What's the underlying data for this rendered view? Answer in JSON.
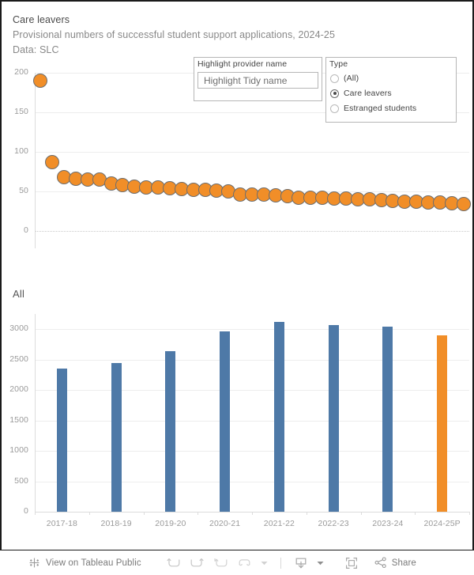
{
  "header": {
    "title": "Care leavers",
    "subtitle": "Provisional numbers of successful student support applications, 2024-25",
    "source": "Data: SLC"
  },
  "filters": {
    "highlight": {
      "title": "Highlight provider name",
      "placeholder": "Highlight Tidy name",
      "value": "",
      "icon": "search-icon"
    },
    "type": {
      "title": "Type",
      "selected": "Care leavers",
      "options": [
        {
          "label": "(All)",
          "checked": false
        },
        {
          "label": "Care leavers",
          "checked": true
        },
        {
          "label": "Estranged students",
          "checked": false
        }
      ]
    }
  },
  "sections": {
    "bar_section_label": "All"
  },
  "colors": {
    "orange": "#f18e28",
    "blue": "#4e79a7",
    "grid": "#ededed",
    "axis_text": "#9a9a9a",
    "title_text": "#4a4a4a",
    "subtitle_text": "#888888"
  },
  "chart_data": [
    {
      "type": "scatter",
      "title": "Care leavers",
      "xlabel": "",
      "ylabel": "",
      "ylim": [
        0,
        200
      ],
      "yticks": [
        0,
        50,
        100,
        150,
        200
      ],
      "grid": true,
      "legend": "none",
      "point_color": "#f18e28",
      "x": [
        1,
        2,
        3,
        4,
        5,
        6,
        7,
        8,
        9,
        10,
        11,
        12,
        13,
        14,
        15,
        16,
        17,
        18,
        19,
        20,
        21,
        22,
        23,
        24,
        25,
        26,
        27,
        28,
        29,
        30,
        31,
        32,
        33,
        34,
        35,
        36,
        37
      ],
      "values": [
        190,
        87,
        68,
        66,
        65,
        65,
        60,
        58,
        56,
        55,
        55,
        54,
        53,
        52,
        52,
        51,
        50,
        46,
        46,
        46,
        45,
        44,
        42,
        42,
        42,
        41,
        41,
        40,
        40,
        39,
        38,
        37,
        37,
        36,
        36,
        35,
        34
      ]
    },
    {
      "type": "bar",
      "title": "All",
      "categories": [
        "2017-18",
        "2018-19",
        "2019-20",
        "2020-21",
        "2021-22",
        "2022-23",
        "2023-24",
        "2024-25P"
      ],
      "values": [
        2350,
        2450,
        2640,
        2970,
        3120,
        3070,
        3040,
        2905
      ],
      "xlabel": "",
      "ylabel": "",
      "ylim": [
        0,
        3250
      ],
      "yticks": [
        0,
        500,
        1000,
        1500,
        2000,
        2500,
        3000
      ],
      "grid": true,
      "legend": "none",
      "bar_colors": [
        "#4e79a7",
        "#4e79a7",
        "#4e79a7",
        "#4e79a7",
        "#4e79a7",
        "#4e79a7",
        "#4e79a7",
        "#f18e28"
      ]
    }
  ],
  "toolbar": {
    "brand_label": "View on Tableau Public",
    "brand_icon": "tableau-logo-icon",
    "buttons": [
      {
        "name": "undo-button",
        "icon": "undo-icon"
      },
      {
        "name": "redo-button",
        "icon": "redo-icon"
      },
      {
        "name": "reset-button",
        "icon": "reset-icon"
      },
      {
        "name": "revert-button",
        "icon": "revert-icon"
      },
      {
        "name": "revert-dropdown",
        "icon": "chevron-down-icon"
      },
      {
        "name": "download-button",
        "icon": "download-icon"
      },
      {
        "name": "download-dropdown",
        "icon": "chevron-down-icon"
      },
      {
        "name": "fullscreen-button",
        "icon": "fullscreen-icon"
      }
    ],
    "share_label": "Share",
    "share_icon": "share-icon"
  }
}
